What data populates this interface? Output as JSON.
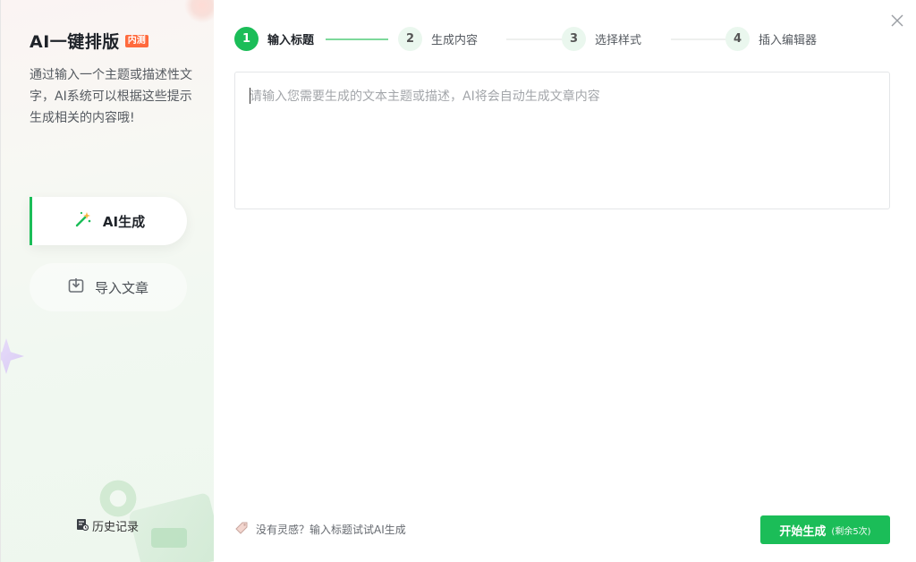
{
  "sidebar": {
    "title": "AI一键排版",
    "badge": "内测",
    "description": "通过输入一个主题或描述性文字，AI系统可以根据这些提示生成相关的内容哦!",
    "modes": [
      {
        "label": "AI生成",
        "icon": "magic-wand-icon",
        "active": true
      },
      {
        "label": "导入文章",
        "icon": "import-icon",
        "active": false
      }
    ],
    "history_label": "历史记录"
  },
  "steps": [
    {
      "number": "1",
      "label": "输入标题",
      "active": true
    },
    {
      "number": "2",
      "label": "生成内容",
      "active": false
    },
    {
      "number": "3",
      "label": "选择样式",
      "active": false
    },
    {
      "number": "4",
      "label": "插入编辑器",
      "active": false
    }
  ],
  "editor": {
    "value": "",
    "placeholder": "请输入您需要生成的文本主题或描述，AI将会自动生成文章内容"
  },
  "footer": {
    "hint": "没有灵感？输入标题试试AI生成",
    "generate_label": "开始生成",
    "remaining_label": "(剩余5次)"
  },
  "colors": {
    "accent": "#1bbd58",
    "badge": "#ff6a3d",
    "step_idle_bg": "#eaf7ee"
  }
}
